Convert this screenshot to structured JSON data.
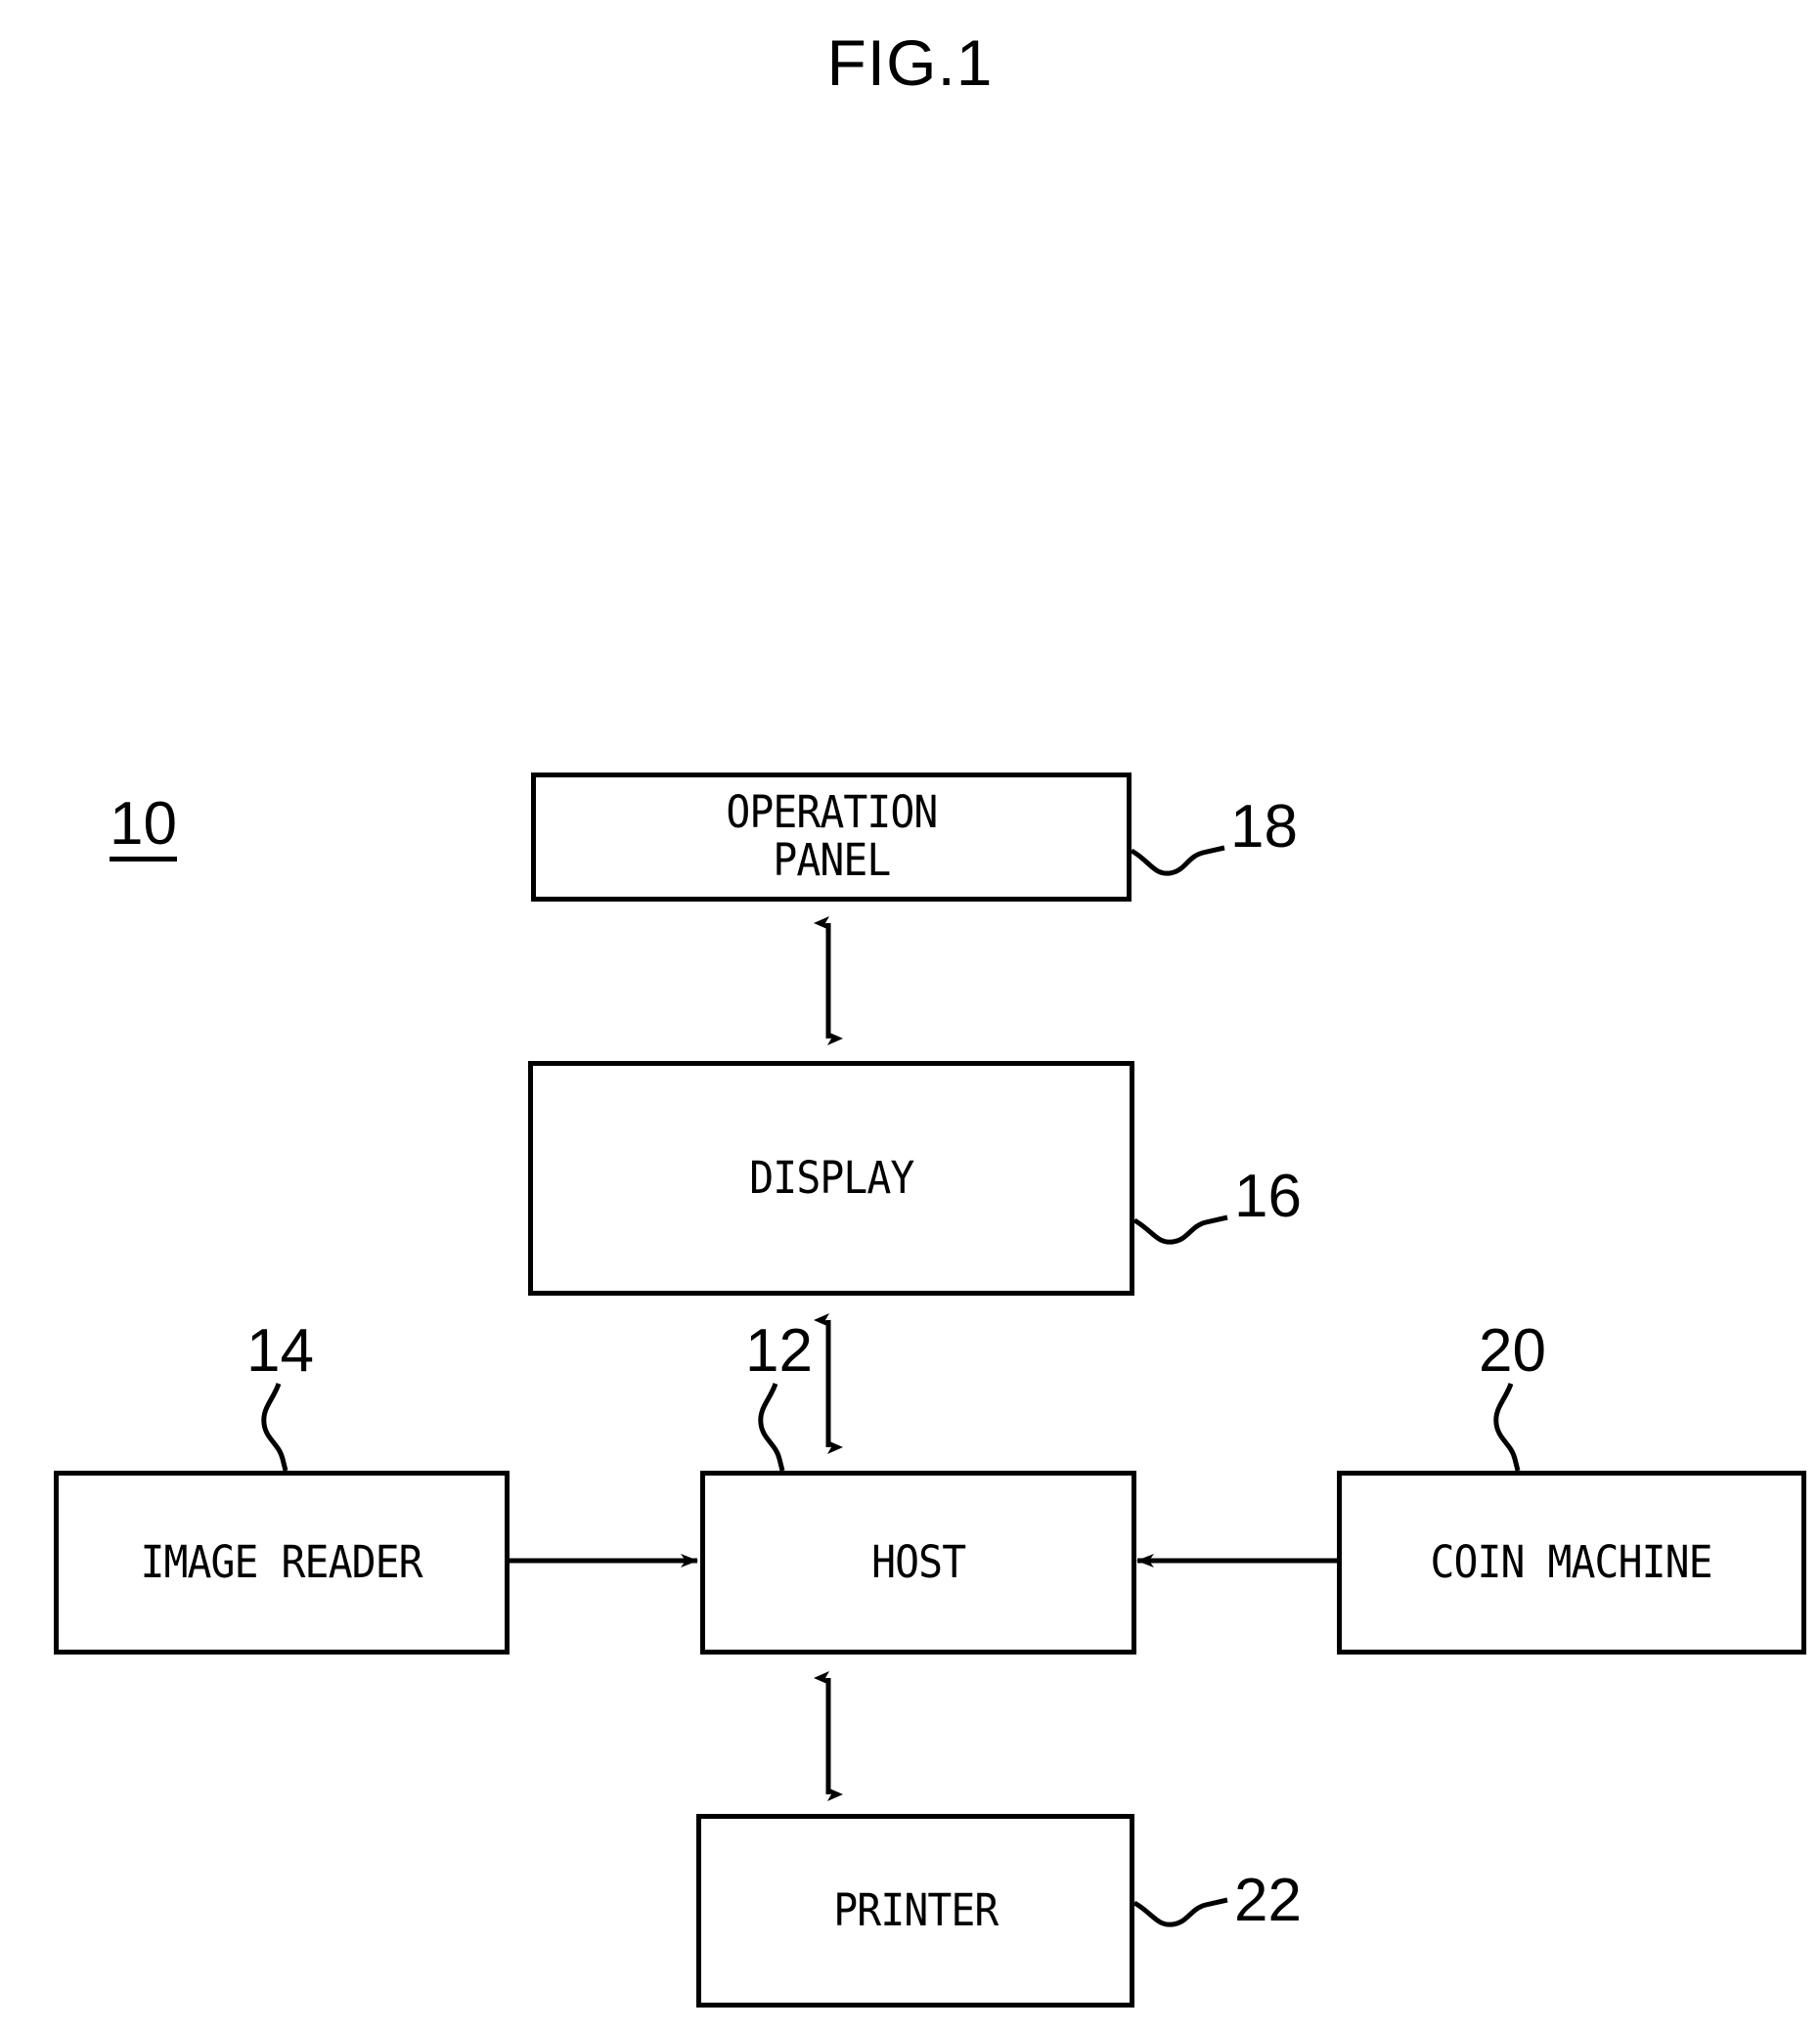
{
  "figure": {
    "title": "FIG.1",
    "assembly_ref": "10",
    "line_color": "#000000",
    "background_color": "#ffffff"
  },
  "nodes": [
    {
      "id": "operation-panel",
      "label": "OPERATION\nPANEL",
      "ref": "18"
    },
    {
      "id": "display",
      "label": "DISPLAY",
      "ref": "16"
    },
    {
      "id": "host",
      "label": "HOST",
      "ref": "12"
    },
    {
      "id": "image-reader",
      "label": "IMAGE READER",
      "ref": "14"
    },
    {
      "id": "coin-machine",
      "label": "COIN MACHINE",
      "ref": "20"
    },
    {
      "id": "printer",
      "label": "PRINTER",
      "ref": "22"
    }
  ],
  "connections": [
    {
      "from": "operation-panel",
      "to": "display",
      "style": "bidirectional-vertical"
    },
    {
      "from": "display",
      "to": "host",
      "style": "bidirectional-vertical"
    },
    {
      "from": "image-reader",
      "to": "host",
      "style": "unidirectional-right"
    },
    {
      "from": "coin-machine",
      "to": "host",
      "style": "unidirectional-left"
    },
    {
      "from": "host",
      "to": "printer",
      "style": "bidirectional-vertical"
    }
  ]
}
